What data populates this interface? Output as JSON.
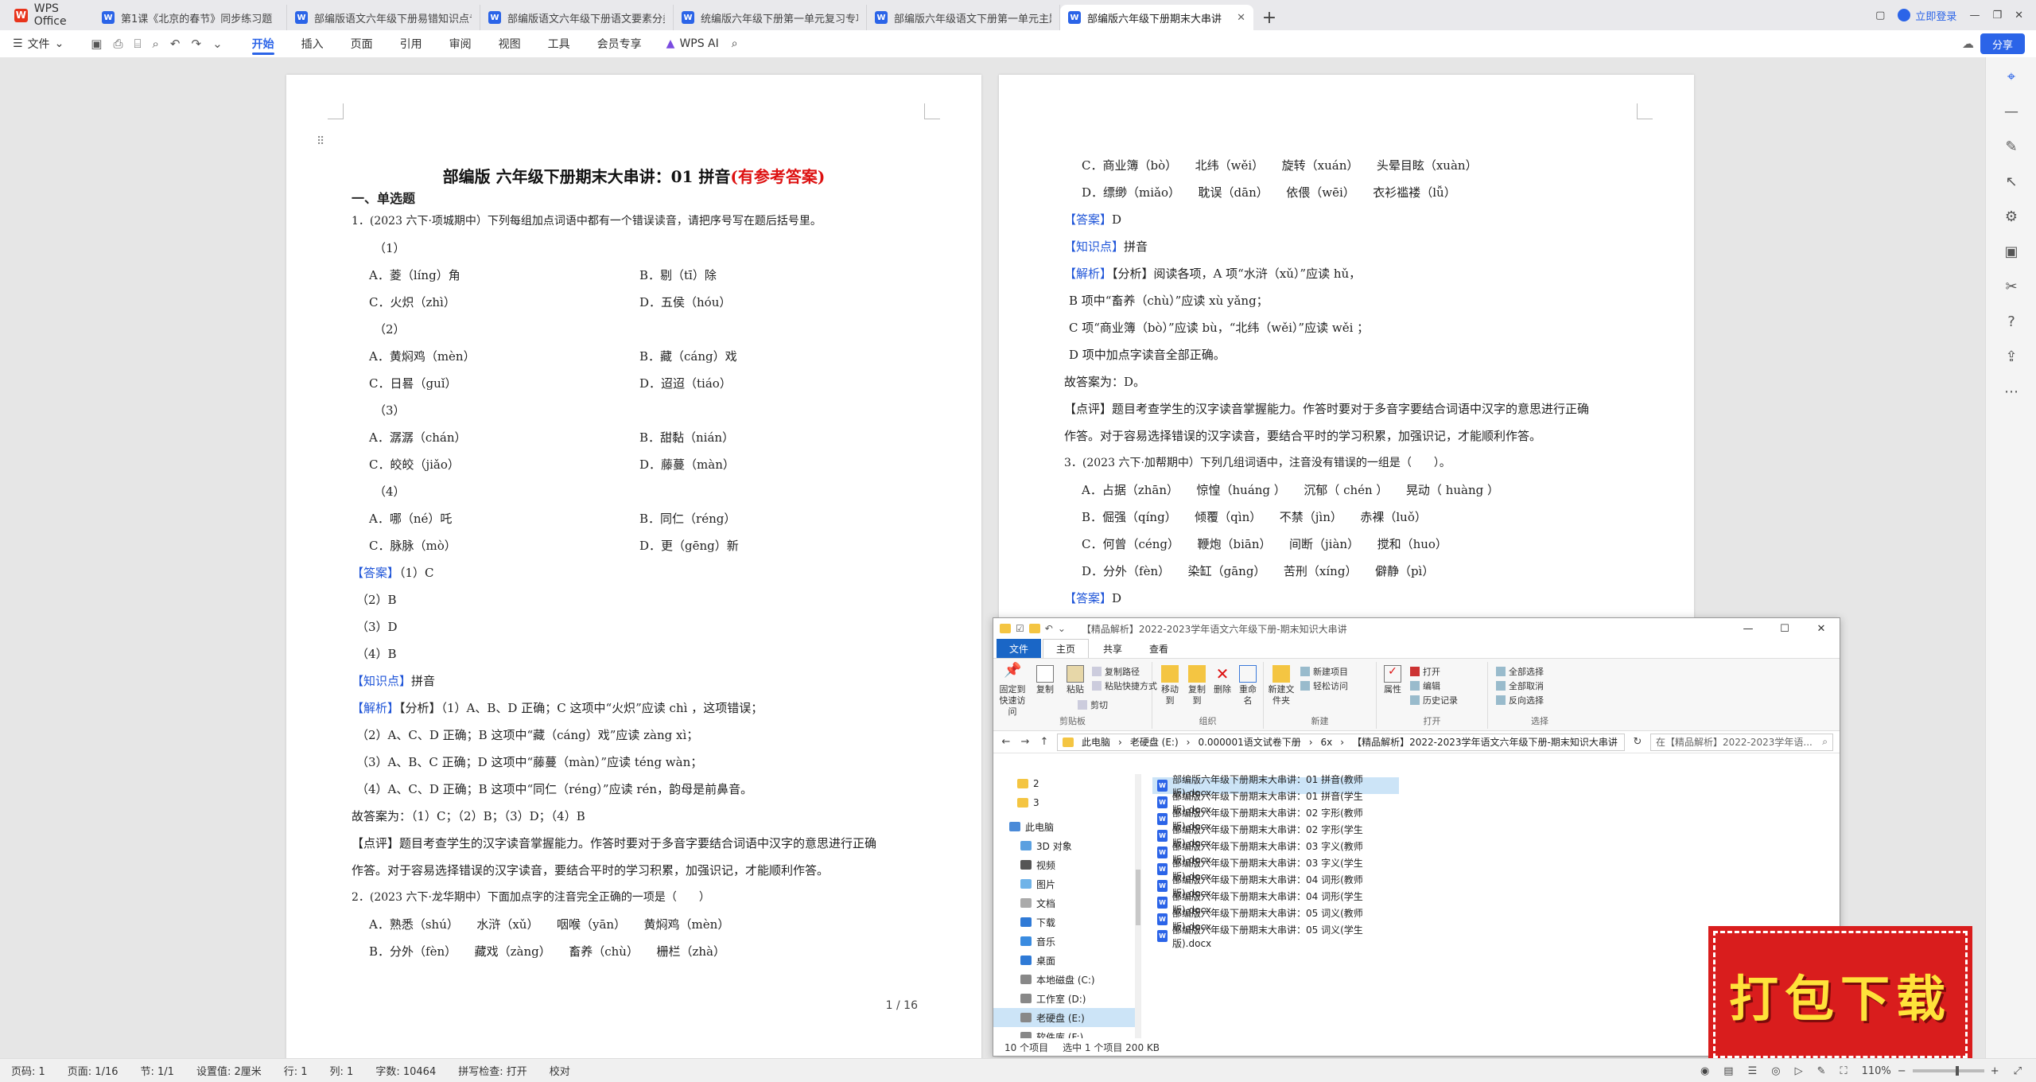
{
  "tabbar": {
    "home": "WPS Office",
    "tabs": [
      {
        "label": "第1课《北京的春节》同步练习题（含"
      },
      {
        "label": "部编版语文六年级下册易错知识点专"
      },
      {
        "label": "部编版语文六年级下册语文要素分类"
      },
      {
        "label": "统编版六年级下册第一单元复习专项"
      },
      {
        "label": "部编版六年级语文下册第一单元主题"
      },
      {
        "label": "部编版六年级下册期末大串讲",
        "active": true
      }
    ],
    "login": "立即登录"
  },
  "ribbon": {
    "file": "文件",
    "tabs": [
      "开始",
      "插入",
      "页面",
      "引用",
      "审阅",
      "视图",
      "工具",
      "会员专享"
    ],
    "ai": "WPS AI",
    "share": "分享"
  },
  "page1": {
    "title": "部编版 六年级下册期末大串讲：01 拼音",
    "title_red": "(有参考答案)",
    "section": "一、单选题",
    "lines": [
      "1．(2023 六下·项城期中）下列每组加点词语中都有一个错误读音，请把序号写在题后括号里。",
      "（1）",
      "A．菱（líng）角",
      "B．剔（tī）除",
      "C．火炽（zhì）",
      "D．五侯（hóu）",
      "（2）",
      "A．黄焖鸡（mèn）",
      "B．藏（cáng）戏",
      "C．日晷（guǐ）",
      "D．迢迢（tiáo）",
      "（3）",
      "A．潺潺（chán）",
      "B．甜黏（nián）",
      "C．皎皎（jiǎo）",
      "D．藤蔓（màn）",
      "（4）",
      "A．哪（né）吒",
      "B．同仁（réng）",
      "C．脉脉（mò）",
      "D．更（gēng）新",
      "【答案】",
      "（1）C",
      "（2）B",
      "（3）D",
      "（4）B",
      "【知识点】",
      "拼音",
      "【解析】",
      "【分析】（1）A、B、D 正确；C 这项中“火炽”应读 chì ，这项错误；",
      "（2）A、C、D 正确；B 这项中“藏（cáng）戏”应读 zàng xì；",
      "（3）A、B、C 正确；D 这项中“藤蔓（màn）”应读 téng wàn；",
      "（4）A、C、D 正确；B 这项中“同仁（réng）”应读 rén，韵母是前鼻音。",
      "故答案为：（1）C；（2）B；（3）D；（4）B",
      "【点评】题目考查学生的汉字读音掌握能力。作答时要对于多音字要结合词语中汉字的意思进行正确",
      "作答。对于容易选择错误的汉字读音，要结合平时的学习积累，加强识记，才能顺利作答。",
      "2．(2023 六下·龙华期中）下面加点字的注音完全正确的一项是（　　）",
      "A．熟悉（shú）　　水浒（xǔ）　　咽喉（yān）　　黄焖鸡（mèn）",
      "B．分外（fèn）　　藏戏（zàng）　　畜养（chù）　　栅栏（zhà）"
    ],
    "page_num": "1 / 16"
  },
  "page2": {
    "lines": [
      "C．商业簿（bò）　　北纬（wěi）　　旋转（xuán）　　头晕目眩（xuàn）",
      "D．缥缈（miǎo）　　耽误（dān）　　依偎（wēi）　　衣衫褴褛（lǚ）",
      "【答案】",
      "D",
      "【知识点】",
      "拼音",
      "【解析】",
      "【分析】阅读各项，A 项“水浒（xǔ）”应读 hǔ，",
      "B 项中“畜养（chù）”应读 xù yǎng；",
      "C 项“商业簿（bò）”应读 bù，“北纬（wěi）”应读 wěi ；",
      "D 项中加点字读音全部正确。",
      "故答案为：D。",
      "【点评】题目考查学生的汉字读音掌握能力。作答时要对于多音字要结合词语中汉字的意思进行正确",
      "作答。对于容易选择错误的汉字读音，要结合平时的学习积累，加强识记，才能顺利作答。",
      "3．(2023 六下·加帮期中）下列几组词语中，注音没有错误的一组是（　　）。",
      "A．占据（zhān）　　惊惶（huáng ）　　沉郁（ chén ）　　晃动（ huàng ）",
      "B．倔强（qíng）　　倾覆（qìn）　　不禁（jìn）　　赤裸（luǒ）",
      "C．何曾（céng）　　鞭炮（biān）　　间断（jiàn）　　搅和（huo）",
      "D．分外（fèn）　　染缸（gāng）　　苦刑（xíng）　　僻静（pì）",
      "【答案】",
      "D"
    ]
  },
  "explorer": {
    "title": "【精品解析】2022-2023学年语文六年级下册-期末知识大串讲",
    "tabs": [
      "文件",
      "主页",
      "共享",
      "查看"
    ],
    "ribbon": {
      "pin": "固定到快速访问",
      "copy": "复制",
      "paste": "粘贴",
      "copy_path": "复制路径",
      "paste_shortcut": "粘贴快捷方式",
      "cut": "剪切",
      "clipboard": "剪贴板",
      "move_to": "移动到",
      "copy_to": "复制到",
      "delete": "删除",
      "rename": "重命名",
      "organize": "组织",
      "new_folder": "新建文件夹",
      "new_item": "新建项目",
      "easy_access": "轻松访问",
      "new": "新建",
      "properties": "属性",
      "open": "打开",
      "edit": "编辑",
      "history": "历史记录",
      "open_group": "打开",
      "select_all": "全部选择",
      "select_none": "全部取消",
      "invert": "反向选择",
      "select": "选择"
    },
    "path": [
      "此电脑",
      "老硬盘 (E:)",
      "0.000001语文试卷下册",
      "6x",
      "【精品解析】2022-2023学年语文六年级下册-期末知识大串讲"
    ],
    "search_placeholder": "在【精品解析】2022-2023学年语...",
    "tree": [
      "2",
      "3",
      "此电脑",
      "3D 对象",
      "视频",
      "图片",
      "文档",
      "下载",
      "音乐",
      "桌面",
      "本地磁盘 (C:)",
      "工作室 (D:)",
      "老硬盘 (E:)",
      "软件库 (F:)"
    ],
    "files": [
      "部编版六年级下册期末大串讲：01 拼音(教师版).docx",
      "部编版六年级下册期末大串讲：01 拼音(学生版).docx",
      "部编版六年级下册期末大串讲：02 字形(教师版).docx",
      "部编版六年级下册期末大串讲：02 字形(学生版).docx",
      "部编版六年级下册期末大串讲：03 字义(教师版).docx",
      "部编版六年级下册期末大串讲：03 字义(学生版).docx",
      "部编版六年级下册期末大串讲：04 词形(教师版).docx",
      "部编版六年级下册期末大串讲：04 词形(学生版).docx",
      "部编版六年级下册期末大串讲：05 词义(教师版).docx",
      "部编版六年级下册期末大串讲：05 词义(学生版).docx"
    ],
    "status_count": "10 个项目",
    "status_selected": "选中 1 个项目  200 KB"
  },
  "download_badge": "打包下载",
  "statusbar": {
    "page_code": "页码: 1",
    "page": "页面: 1/16",
    "section": "节: 1/1",
    "setting": "设置值: 2厘米",
    "row": "行: 1",
    "col": "列: 1",
    "words": "字数: 10464",
    "spell": "拼写检查: 打开",
    "proof": "校对",
    "zoom": "110%"
  }
}
